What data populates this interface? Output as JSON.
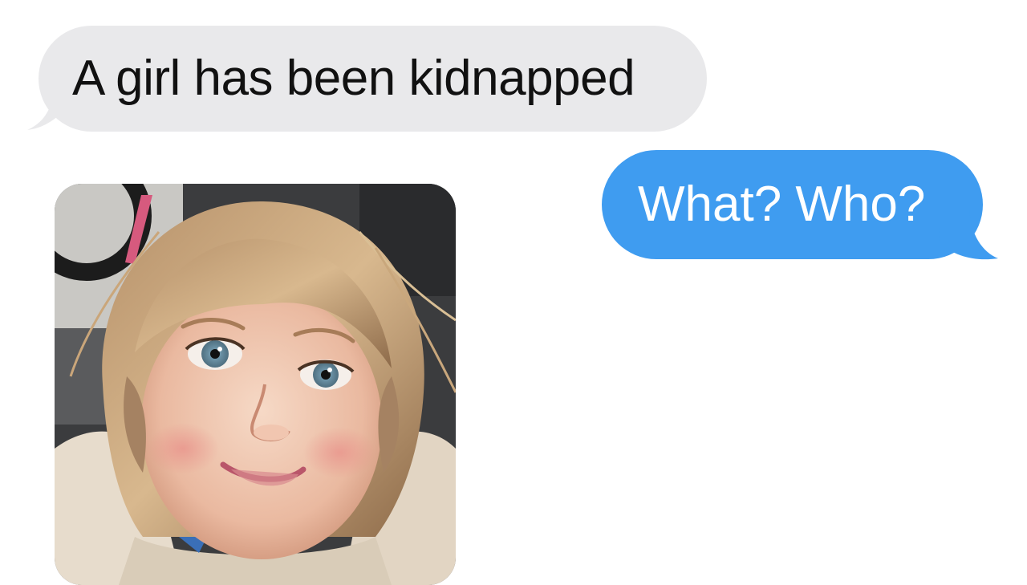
{
  "conversation": {
    "messages": [
      {
        "direction": "incoming",
        "kind": "text",
        "text": "A girl has been kidnapped"
      },
      {
        "direction": "outgoing",
        "kind": "text",
        "text": "What? Who?"
      },
      {
        "direction": "incoming",
        "kind": "image",
        "icon": "photo-of-young-girl"
      }
    ]
  },
  "colors": {
    "incoming_bubble": "#e9e9eb",
    "outgoing_bubble": "#3f9cf0",
    "incoming_text": "#111111",
    "outgoing_text": "#ffffff",
    "background": "#ffffff"
  }
}
